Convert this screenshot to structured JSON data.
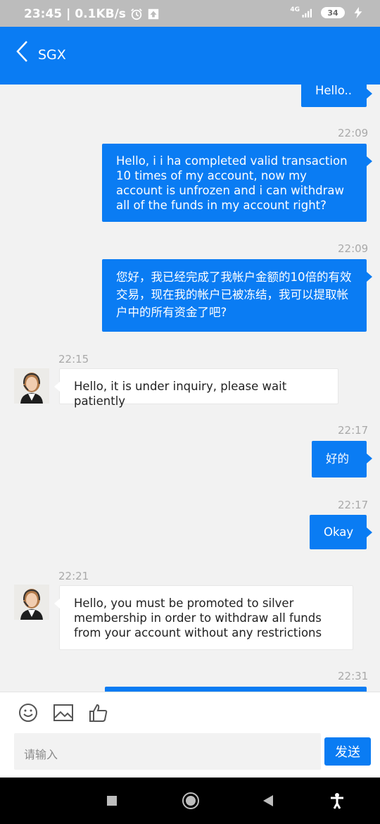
{
  "status_bar": {
    "time": "23:45",
    "speed": "0.1KB/s",
    "network": "4G",
    "battery": "34"
  },
  "header": {
    "title": "SGX"
  },
  "messages": [
    {
      "side": "me",
      "time": "",
      "text": "Hello.."
    },
    {
      "side": "me",
      "time": "22:09",
      "text": "Hello, i i ha completed valid transaction 10 times of my account, now my account is unfrozen and i can withdraw all of the funds in my account right?"
    },
    {
      "side": "me",
      "time": "22:09",
      "text": "您好，我已经完成了我帐户金额的10倍的有效交易，现在我的帐户已被冻结，我可以提取帐户中的所有资金了吧?"
    },
    {
      "side": "them",
      "time": "22:15",
      "text": "Hello, it is under inquiry, please wait patiently"
    },
    {
      "side": "me",
      "time": "22:17",
      "text": "好的"
    },
    {
      "side": "me",
      "time": "22:17",
      "text": "Okay"
    },
    {
      "side": "them",
      "time": "22:21",
      "text": "Hello, you must be promoted to silver membership in order to withdraw all funds from your account without any restrictions"
    },
    {
      "side": "me",
      "time": "22:31",
      "text": ""
    }
  ],
  "composer": {
    "placeholder": "请输入",
    "send_label": "发送"
  },
  "icons": {
    "emoji": "emoji-icon",
    "image": "image-icon",
    "like": "thumbs-up-icon",
    "back": "back-chevron-icon",
    "recents": "recents-square-icon",
    "home": "home-circle-icon",
    "nav_back": "nav-back-triangle-icon",
    "accessibility": "accessibility-icon"
  },
  "colors": {
    "brand_blue": "#0a7cf3",
    "chat_bg": "#f2f2f2",
    "timestamp": "#a9a9a9"
  }
}
